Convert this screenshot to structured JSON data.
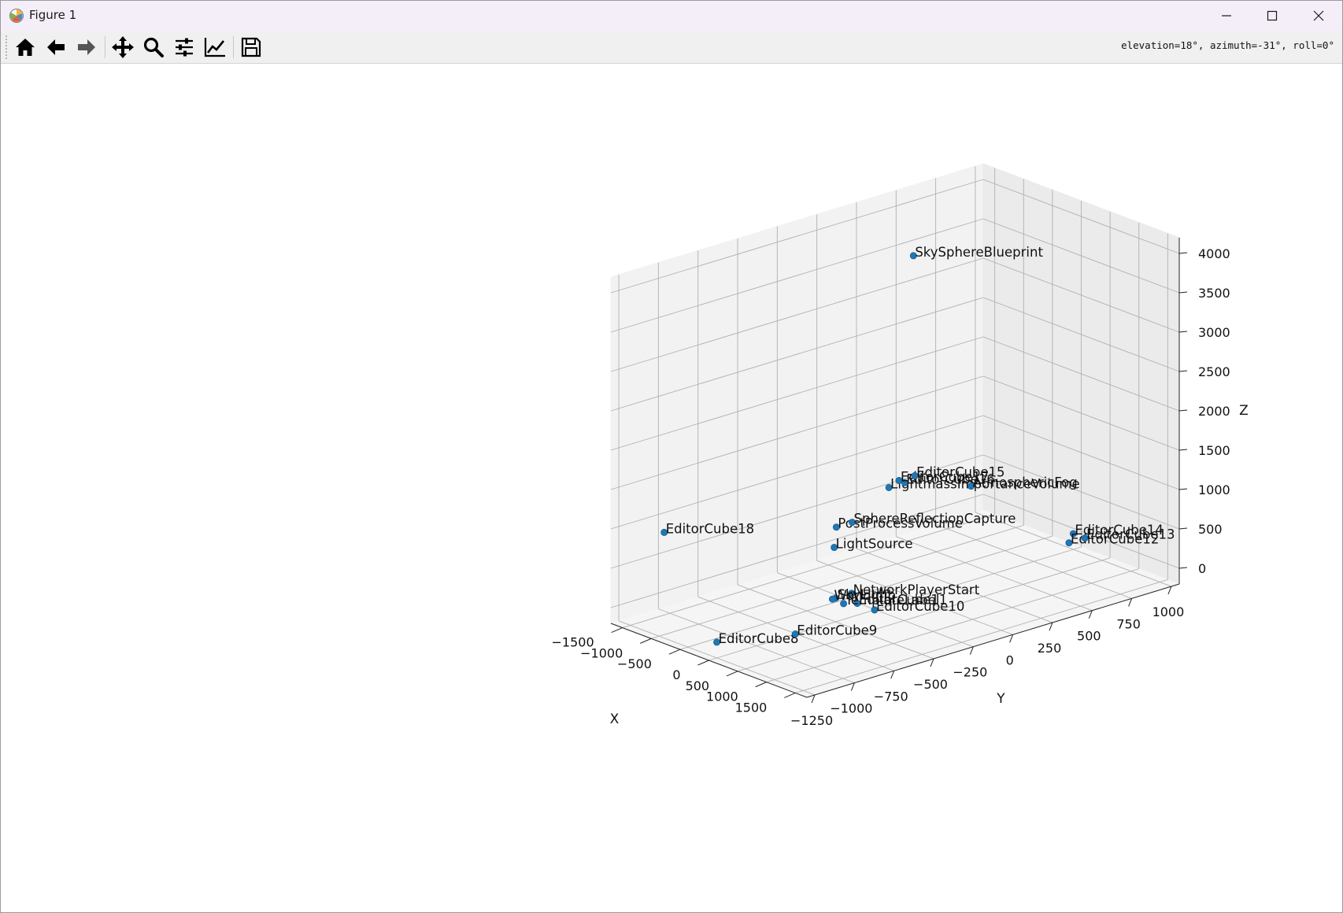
{
  "window": {
    "title": "Figure 1",
    "icon": "matplotlib-icon",
    "controls": [
      "minimize-icon",
      "maximize-icon",
      "close-icon"
    ]
  },
  "toolbar": {
    "buttons": [
      {
        "name": "home",
        "icon": "home-icon"
      },
      {
        "name": "back",
        "icon": "arrow-left-icon"
      },
      {
        "name": "forward",
        "icon": "arrow-right-icon"
      },
      {
        "name": "pan",
        "icon": "move-icon"
      },
      {
        "name": "zoom",
        "icon": "zoom-icon"
      },
      {
        "name": "subplots",
        "icon": "sliders-icon"
      },
      {
        "name": "edit-curves",
        "icon": "line-chart-icon"
      },
      {
        "name": "save",
        "icon": "floppy-disk-icon"
      }
    ],
    "status": "elevation=18°, azimuth=-31°, roll=0°"
  },
  "chart_data": {
    "type": "scatter",
    "projection": "3d",
    "view": {
      "elevation": 18,
      "azimuth": -31,
      "roll": 0
    },
    "xlabel": "X",
    "ylabel": "Y",
    "zlabel": "Z",
    "xlim": [
      -1700,
      1700
    ],
    "ylim": [
      -1300,
      1050
    ],
    "zlim": [
      -200,
      4200
    ],
    "xticks": [
      -1500,
      -1000,
      -500,
      0,
      500,
      1000,
      1500
    ],
    "yticks": [
      -1250,
      -1000,
      -750,
      -500,
      -250,
      0,
      250,
      500,
      750,
      1000
    ],
    "zticks": [
      0,
      500,
      1000,
      1500,
      2000,
      2500,
      3000,
      3500,
      4000
    ],
    "grid": true,
    "point_color": "#1f77b4",
    "points": [
      {
        "label": "SkySphereBlueprint",
        "x": -300,
        "y": 100,
        "z": 4000
      },
      {
        "label": "EditorCube18",
        "x": -1600,
        "y": -1000,
        "z": 800
      },
      {
        "label": "EditorCube8",
        "x": 0,
        "y": -1250,
        "z": 0
      },
      {
        "label": "EditorCube9",
        "x": 400,
        "y": -900,
        "z": 0
      },
      {
        "label": "EditorCube10",
        "x": 400,
        "y": -400,
        "z": 0
      },
      {
        "label": "EditorCube11",
        "x": 100,
        "y": -400,
        "z": 0
      },
      {
        "label": "TemplateLabel",
        "x": 0,
        "y": -450,
        "z": 0
      },
      {
        "label": "NetworkPlayerStart",
        "x": 0,
        "y": -400,
        "z": 100
      },
      {
        "label": "SkyLight",
        "x": 0,
        "y": -500,
        "z": 100
      },
      {
        "label": "WorldInfo",
        "x": 0,
        "y": -520,
        "z": 100
      },
      {
        "label": "LightSource",
        "x": -300,
        "y": -400,
        "z": 600
      },
      {
        "label": "PostProcessVolume",
        "x": -400,
        "y": -350,
        "z": 800
      },
      {
        "label": "SphereReflectionCapture",
        "x": -400,
        "y": -250,
        "z": 800
      },
      {
        "label": "LightmassImportanceVolume",
        "x": -1000,
        "y": 200,
        "z": 800
      },
      {
        "label": "EditorCube16",
        "x": -1000,
        "y": 300,
        "z": 800
      },
      {
        "label": "EditorCube17",
        "x": -1100,
        "y": 300,
        "z": 800
      },
      {
        "label": "EditorCube15",
        "x": -1100,
        "y": 400,
        "z": 800
      },
      {
        "label": "AtmosphericFog",
        "x": -400,
        "y": 500,
        "z": 800
      },
      {
        "label": "EditorCube14",
        "x": 0,
        "y": 1000,
        "z": 0
      },
      {
        "label": "EditorCube12",
        "x": 200,
        "y": 900,
        "z": 0
      },
      {
        "label": "EditorCube13",
        "x": 200,
        "y": 1000,
        "z": 0
      }
    ]
  }
}
